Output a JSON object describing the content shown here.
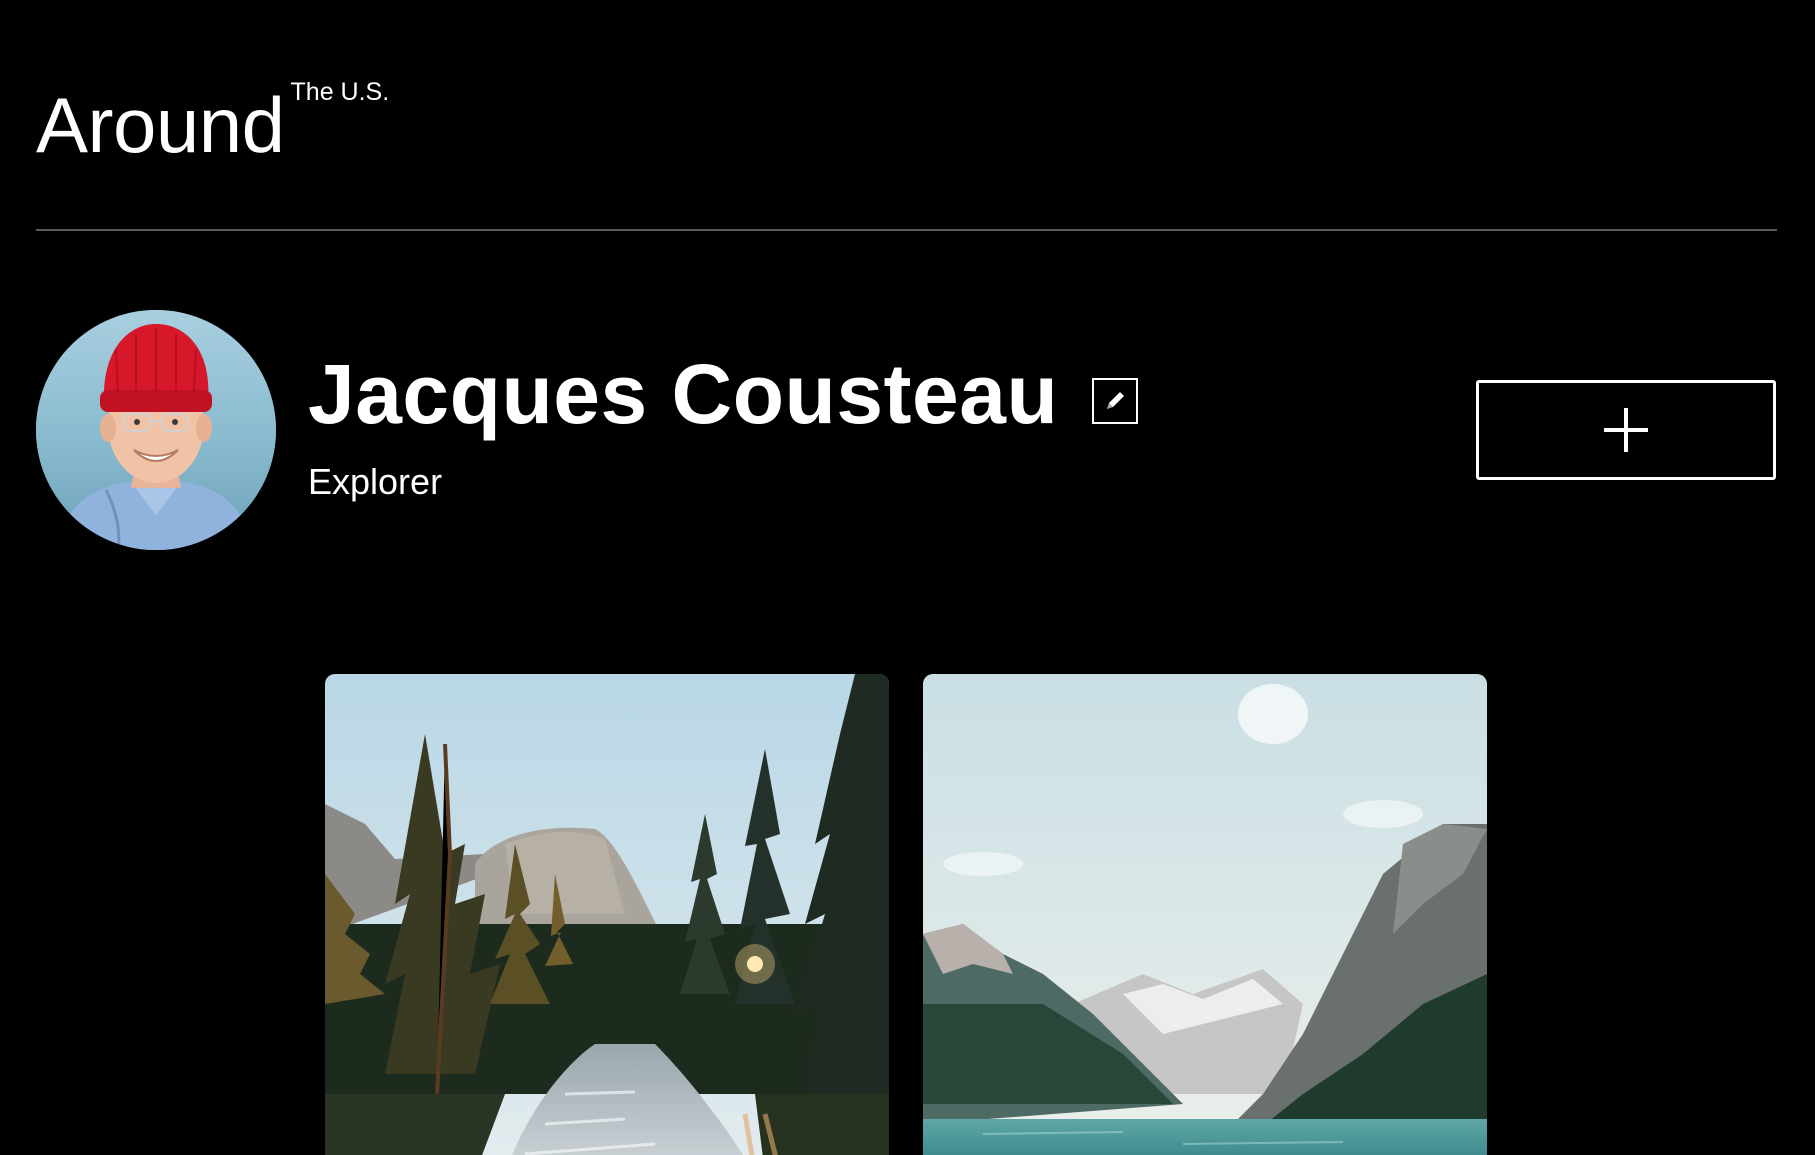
{
  "header": {
    "logo_main": "Around",
    "logo_sup": "The U.S."
  },
  "profile": {
    "name": "Jacques Cousteau",
    "role": "Explorer"
  },
  "icons": {
    "edit": "pencil-icon",
    "add": "plus-icon"
  },
  "cards": [
    {
      "image": "forest-river-valley-photo"
    },
    {
      "image": "mountain-lake-photo"
    }
  ],
  "colors": {
    "background": "#000000",
    "text": "#ffffff",
    "divider": "#5a5a5a"
  }
}
